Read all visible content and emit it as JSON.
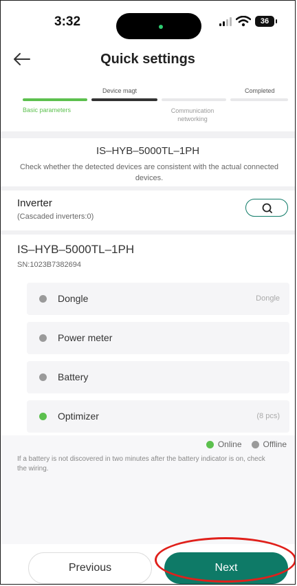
{
  "status_bar": {
    "time": "3:32",
    "battery": "36",
    "island_dot_color": "#2ecc71"
  },
  "header": {
    "title": "Quick settings",
    "back_icon": "back-arrow-icon"
  },
  "steps": {
    "items": [
      {
        "top_label": "",
        "bottom_label": "Basic parameters",
        "state": "done"
      },
      {
        "top_label": "Device magt",
        "bottom_label": "",
        "state": "current"
      },
      {
        "top_label": "",
        "bottom_label": "Communication networking",
        "state": "todo"
      },
      {
        "top_label": "Completed",
        "bottom_label": "",
        "state": "todo"
      }
    ],
    "colors": {
      "done": "#5cc04e",
      "current": "#333333",
      "todo": "#e8e8ea"
    }
  },
  "device_check": {
    "model": "IS–HYB–5000TL–1PH",
    "description": "Check whether the detected devices are consistent with the actual connected devices."
  },
  "inverter": {
    "label": "Inverter",
    "cascaded": "(Cascaded inverters:0)",
    "search_icon": "search-icon"
  },
  "device": {
    "name": "IS–HYB–5000TL–1PH",
    "sn": "SN:1023B7382694"
  },
  "components": [
    {
      "label": "Dongle",
      "value": "Dongle",
      "status": "offline"
    },
    {
      "label": "Power meter",
      "value": "",
      "status": "offline"
    },
    {
      "label": "Battery",
      "value": "",
      "status": "offline"
    },
    {
      "label": "Optimizer",
      "value": "(8 pcs)",
      "status": "online"
    }
  ],
  "legend": {
    "online": "Online",
    "offline": "Offline",
    "online_color": "#5cc04e",
    "offline_color": "#9a9a9a"
  },
  "note": "If a battery is not discovered in two minutes after the battery indicator is on, check the wiring.",
  "footer": {
    "previous": "Previous",
    "next": "Next",
    "accent": "#0e7a67",
    "highlight": "#e0201b"
  }
}
